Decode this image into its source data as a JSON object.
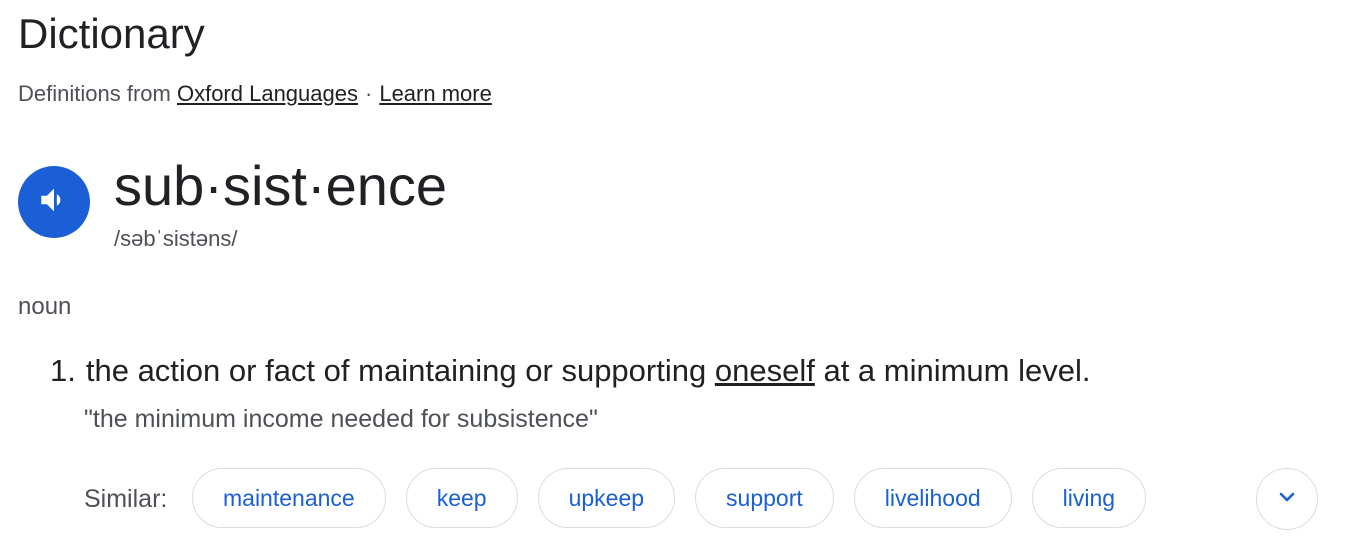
{
  "header": {
    "title": "Dictionary",
    "source_prefix": "Definitions from",
    "source_link": "Oxford Languages",
    "separator": "·",
    "learn_more": "Learn more"
  },
  "entry": {
    "speaker_icon": "volume-icon",
    "headword": "sub·sist·ence",
    "phonetic": "/səbˈsistəns/",
    "part_of_speech": "noun",
    "definition": {
      "number": "1.",
      "text_before": "the action or fact of maintaining or supporting",
      "link_word": "oneself",
      "text_after": "at a minimum level.",
      "example": "\"the minimum income needed for subsistence\""
    },
    "similar": {
      "label": "Similar:",
      "items": [
        "maintenance",
        "keep",
        "upkeep",
        "support",
        "livelihood",
        "living"
      ],
      "expand_icon": "chevron-down-icon"
    }
  },
  "colors": {
    "accent": "#1a5fd6",
    "text": "#202124",
    "secondary": "#4d5156",
    "border": "#dadce0"
  }
}
